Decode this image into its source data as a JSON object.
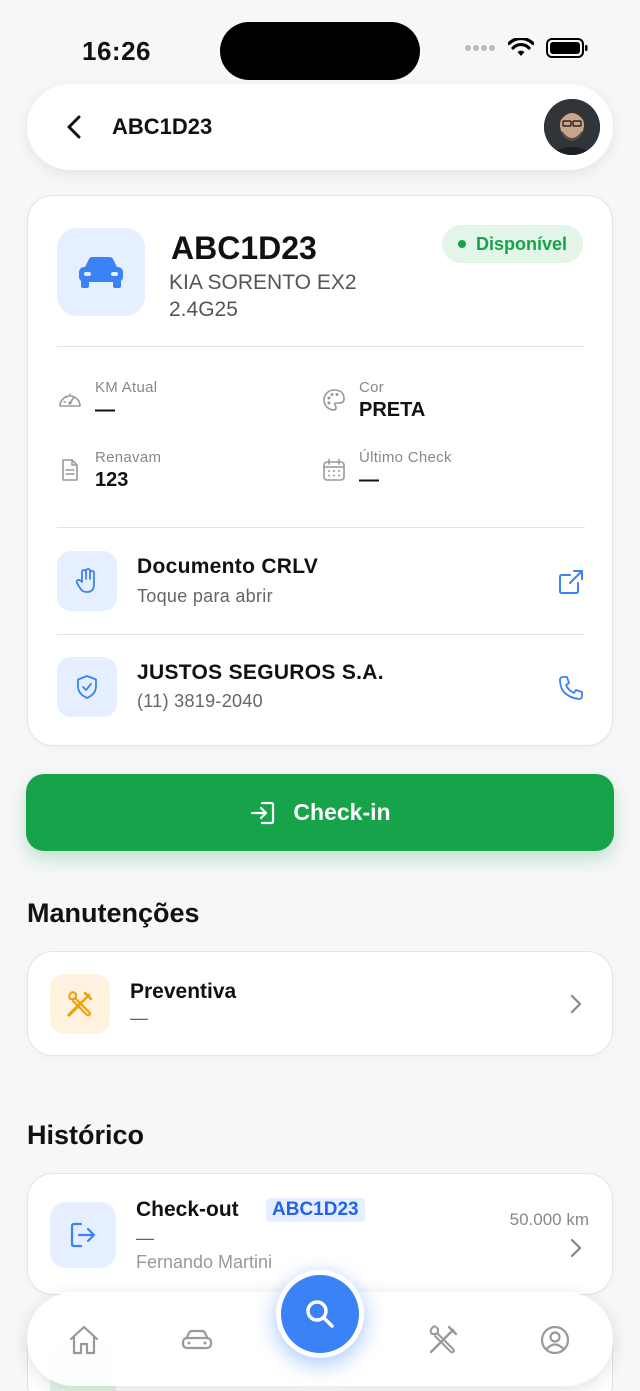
{
  "status_bar": {
    "time": "16:26"
  },
  "header": {
    "title": "ABC1D23"
  },
  "vehicle": {
    "plate": "ABC1D23",
    "model": "KIA SORENTO EX2 2.4G25",
    "status": "Disponível",
    "fields": {
      "km_label": "KM Atual",
      "km_value": "—",
      "color_label": "Cor",
      "color_value": "PRETA",
      "renavam_label": "Renavam",
      "renavam_value": "123",
      "last_check_label": "Último Check",
      "last_check_value": "—"
    },
    "document": {
      "title": "Documento CRLV",
      "subtitle": "Toque para abrir"
    },
    "insurance": {
      "title": "JUSTOS SEGUROS S.A.",
      "phone": "(11) 3819-2040"
    }
  },
  "checkin_button": {
    "label": "Check-in"
  },
  "maintenance": {
    "section_title": "Manutenções",
    "items": [
      {
        "title": "Preventiva",
        "subtitle": "—"
      }
    ]
  },
  "history": {
    "section_title": "Histórico",
    "items": [
      {
        "title": "Check-out",
        "plate": "ABC1D23",
        "subtitle": "—",
        "user": "Fernando Martini",
        "km": "50.000 km"
      }
    ]
  },
  "tab_bar": {
    "items": [
      "home-icon",
      "car-icon",
      "search-icon",
      "tools-icon",
      "profile-icon"
    ]
  },
  "colors": {
    "accent": "#3b82f6",
    "success": "#16a34a",
    "warning": "#f59e0b"
  }
}
